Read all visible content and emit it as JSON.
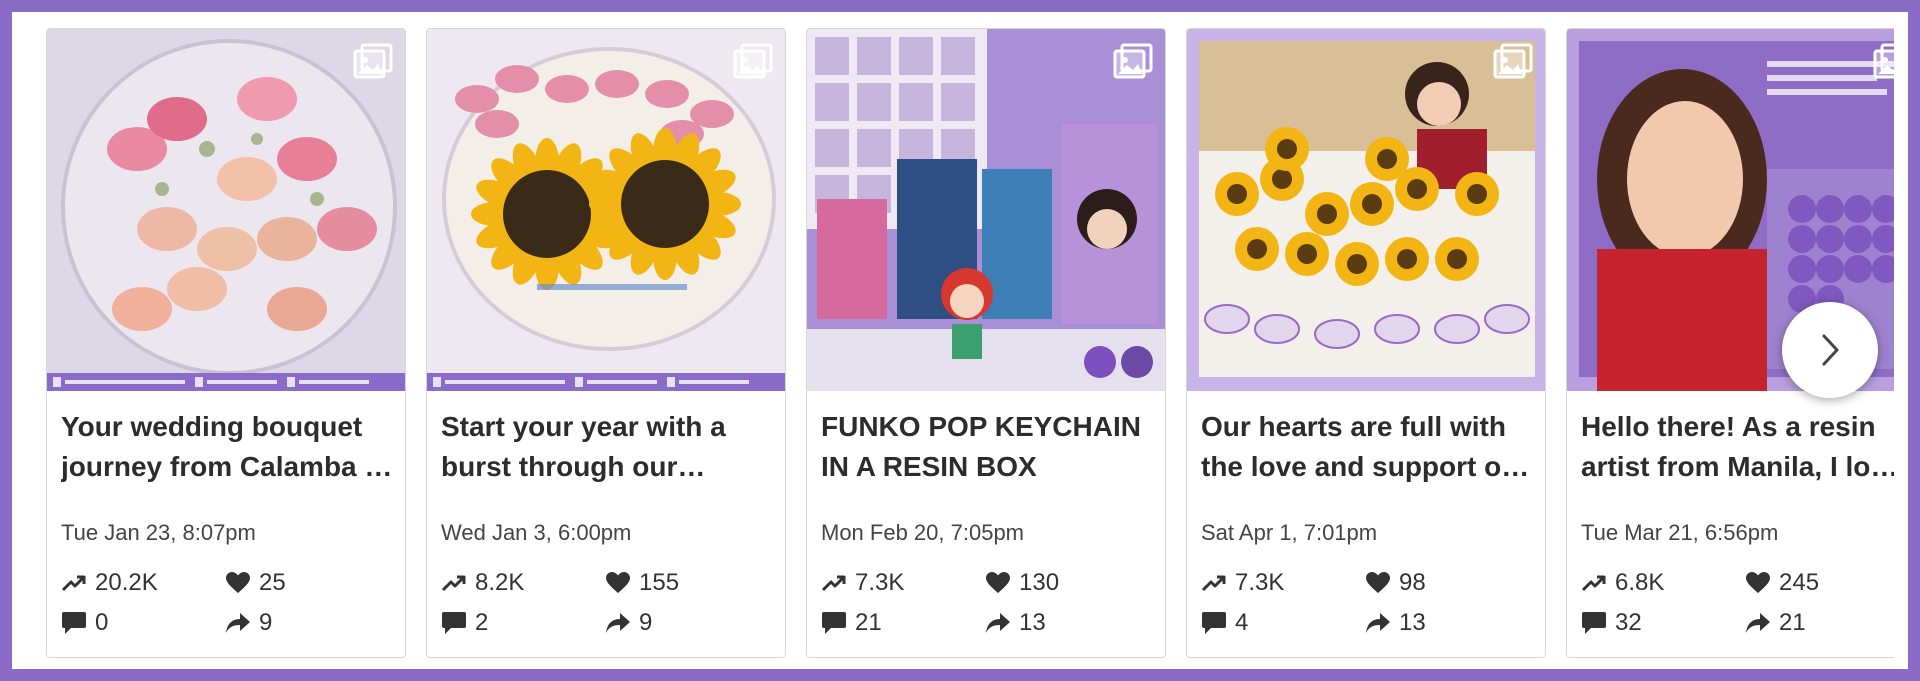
{
  "icons": {
    "media": "image-gallery-icon",
    "reach": "trending-up-icon",
    "likes": "heart-icon",
    "comments": "comment-icon",
    "shares": "share-arrow-icon",
    "next": "chevron-right-icon"
  },
  "colors": {
    "frame": "#8a6cc6",
    "text": "#2c2c2c",
    "brand_strip": "#8b6bc9"
  },
  "posts": [
    {
      "caption": "Your wedding bouquet journey from Calamba to Manila, preserved in resin forever",
      "date": "Tue Jan 23, 8:07pm",
      "reach": "20.2K",
      "likes": "25",
      "comments": "0",
      "shares": "9",
      "theme": "bouquet"
    },
    {
      "caption": "Start your year with a burst through our sunflower keepsakes",
      "date": "Wed Jan 3, 6:00pm",
      "reach": "8.2K",
      "likes": "155",
      "comments": "2",
      "shares": "9",
      "theme": "sunflower"
    },
    {
      "caption": "FUNKO POP KEYCHAIN IN A RESIN BOX",
      "date": "Mon Feb 20, 7:05pm",
      "reach": "7.3K",
      "likes": "130",
      "comments": "21",
      "shares": "13",
      "theme": "funko"
    },
    {
      "caption": "Our hearts are full with the love and support of our customers",
      "date": "Sat Apr 1, 7:01pm",
      "reach": "7.3K",
      "likes": "98",
      "comments": "4",
      "shares": "13",
      "theme": "table"
    },
    {
      "caption": "Hello there! As a resin artist from Manila, I love what I do",
      "date": "Tue Mar 21, 6:56pm",
      "reach": "6.8K",
      "likes": "245",
      "comments": "32",
      "shares": "21",
      "theme": "portrait"
    }
  ]
}
